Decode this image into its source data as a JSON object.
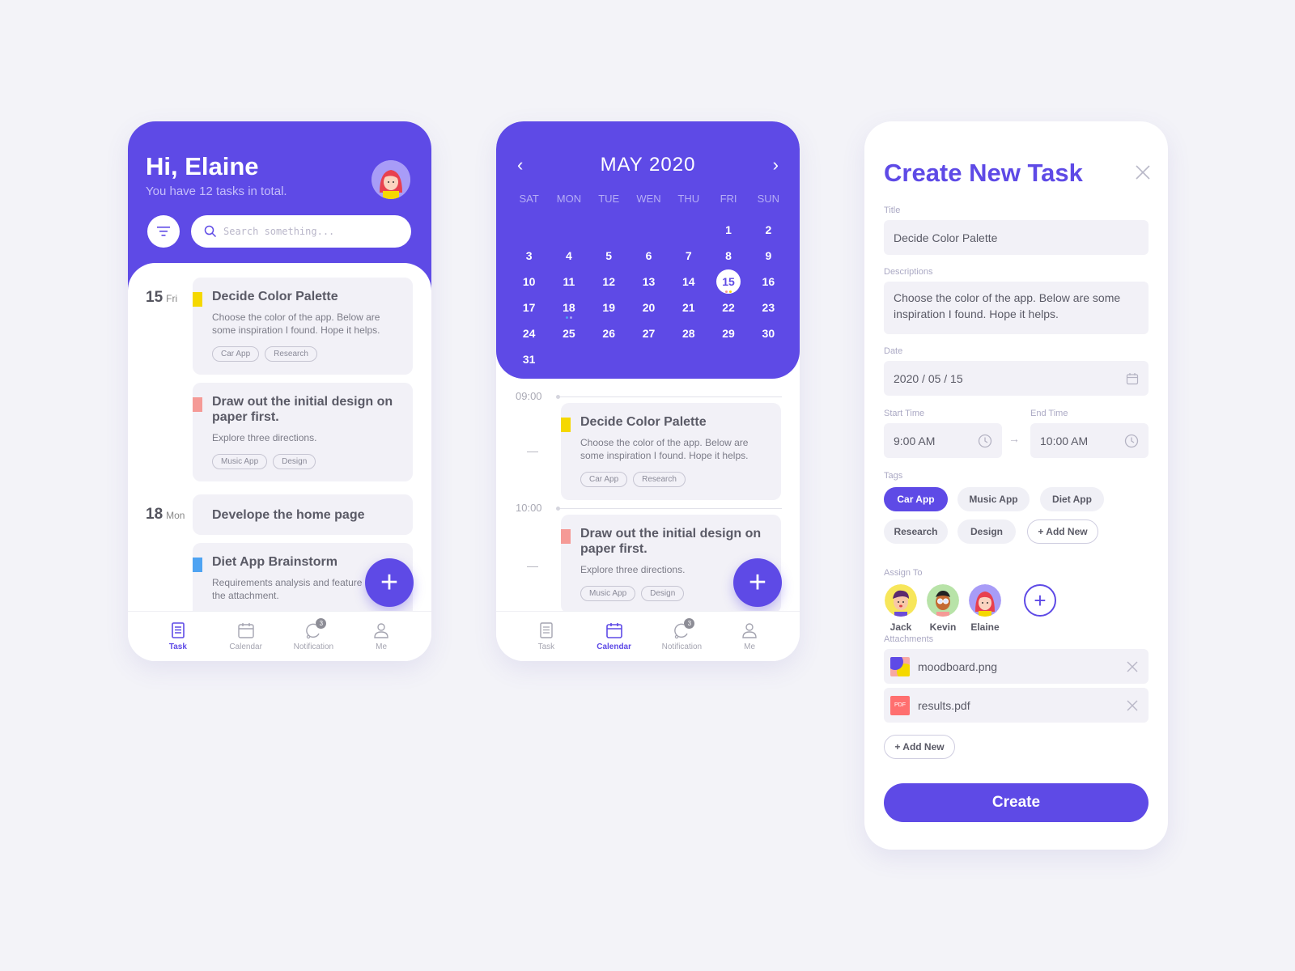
{
  "colors": {
    "accent": "#5e4ae6",
    "yellow": "#f5d800",
    "pink": "#f59a96",
    "blue": "#4ea3f2",
    "background": "#f3f3f8"
  },
  "task_screen": {
    "greeting": "Hi, Elaine",
    "subtitle": "You have 12 tasks in total.",
    "search_placeholder": "Search something...",
    "days": [
      {
        "day": "15",
        "weekday": "Fri"
      },
      {
        "day": "18",
        "weekday": "Mon"
      }
    ],
    "tasks": [
      {
        "title": "Decide Color Palette",
        "desc": "Choose the color of the app. Below are some inspiration I found. Hope it helps.",
        "tags": [
          "Car App",
          "Research"
        ],
        "color": "yellow"
      },
      {
        "title": "Draw out the initial design on paper first.",
        "desc": "Explore three directions.",
        "tags": [
          "Music App",
          "Design"
        ],
        "color": "pink"
      },
      {
        "title": "Develope the home page"
      },
      {
        "title": "Diet App Brainstorm",
        "desc": "Requirements analysis and feature the attachment.",
        "color": "blue"
      }
    ],
    "fab": "+"
  },
  "tabbar": {
    "items": [
      {
        "label": "Task",
        "icon": "document-icon"
      },
      {
        "label": "Calendar",
        "icon": "calendar-icon"
      },
      {
        "label": "Notification",
        "icon": "bell-icon",
        "badge": "3"
      },
      {
        "label": "Me",
        "icon": "user-icon"
      }
    ]
  },
  "calendar_screen": {
    "month": "MAY  2020",
    "prev": "‹",
    "next": "›",
    "weekdays": [
      "SAT",
      "MON",
      "TUE",
      "WEN",
      "THU",
      "FRI",
      "SUN"
    ],
    "leading_blanks": 5,
    "days_in_month": 31,
    "selected_day": 15,
    "event_dots": {
      "15": [
        "#f59a96",
        "#f5d800"
      ],
      "18": [
        "#4ea3f2",
        "#a9a0f5"
      ]
    },
    "timeline": [
      {
        "time": "09:00"
      },
      {
        "time": "10:00"
      }
    ],
    "tasks": [
      {
        "title": "Decide Color Palette",
        "desc": "Choose the color of the app. Below are some inspiration I found. Hope it helps.",
        "tags": [
          "Car App",
          "Research"
        ]
      },
      {
        "title": "Draw out the initial design on paper first.",
        "desc": "Explore three directions.",
        "tags": [
          "Music App",
          "Design"
        ]
      }
    ],
    "fab": "+"
  },
  "create_screen": {
    "title": "Create New Task",
    "labels": {
      "title": "Title",
      "desc": "Descriptions",
      "date": "Date",
      "start": "Start Time",
      "end": "End Time",
      "tags": "Tags",
      "assign": "Assign To",
      "attachments": "Attachments"
    },
    "values": {
      "title": "Decide Color Palette",
      "desc": "Choose the color of the app. Below are some inspiration I found. Hope it helps.",
      "date": "2020 / 05 / 15",
      "start": "9:00 AM",
      "end": "10:00 AM"
    },
    "arrow": "→",
    "tags": [
      {
        "label": "Car App",
        "selected": true
      },
      {
        "label": "Music App",
        "selected": false
      },
      {
        "label": "Diet App",
        "selected": false
      },
      {
        "label": "Research",
        "selected": false
      },
      {
        "label": "Design",
        "selected": false
      },
      {
        "label": "+ Add New",
        "selected": false
      }
    ],
    "assignees": [
      "Jack",
      "Kevin",
      "Elaine"
    ],
    "add_assignee": "+",
    "attachments": [
      {
        "name": "moodboard.png"
      },
      {
        "name": "results.pdf",
        "type_label": "PDF"
      }
    ],
    "add_attachment": "+ Add New",
    "create_button": "Create"
  }
}
